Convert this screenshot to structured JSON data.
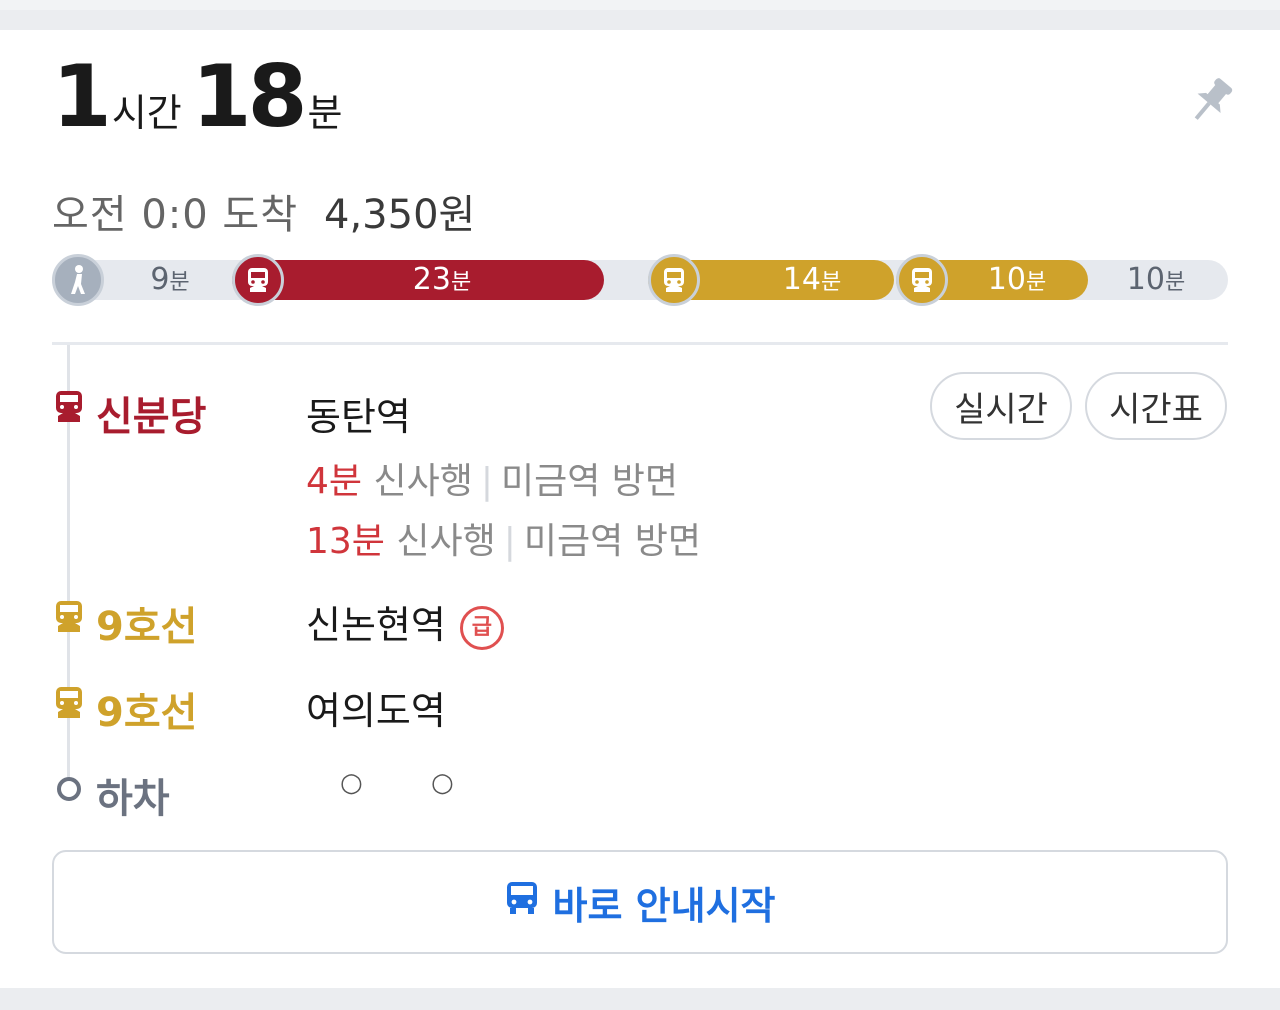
{
  "summary": {
    "hours": "1",
    "hours_unit": "시간",
    "minutes": "18",
    "minutes_unit": "분",
    "arrival_text": "오전 0:0 도착",
    "fare": "4,350원"
  },
  "segments": [
    {
      "type": "walk",
      "label": "9",
      "unit": "분",
      "color": "#a6b0bd"
    },
    {
      "type": "subway",
      "label": "23",
      "unit": "분",
      "color": "#a81c2e"
    },
    {
      "type": "subway",
      "label": "14",
      "unit": "분",
      "color": "#cfa22b"
    },
    {
      "type": "subway",
      "label": "10",
      "unit": "분",
      "color": "#cfa22b"
    },
    {
      "type": "walk",
      "label": "10",
      "unit": "분",
      "color": "#a6b0bd"
    }
  ],
  "steps": {
    "boarding": {
      "line": "신분당",
      "color": "#a81c2e",
      "station": "동탄역",
      "arrivals": [
        {
          "minutes": "4분",
          "direction": "신사행",
          "bound": "미금역 방면"
        },
        {
          "minutes": "13분",
          "direction": "신사행",
          "bound": "미금역 방면"
        }
      ],
      "realtime_label": "실시간",
      "timetable_label": "시간표"
    },
    "transfer1": {
      "line": "9호선",
      "color": "#cfa22b",
      "station": "신논현역",
      "express_badge": "급"
    },
    "transfer2": {
      "line": "9호선",
      "color": "#cfa22b",
      "station": "여의도역"
    },
    "alight": {
      "label": "하차",
      "station": "○ ○"
    }
  },
  "start_button": {
    "label": "바로 안내시작",
    "color": "#1f6fe0"
  }
}
